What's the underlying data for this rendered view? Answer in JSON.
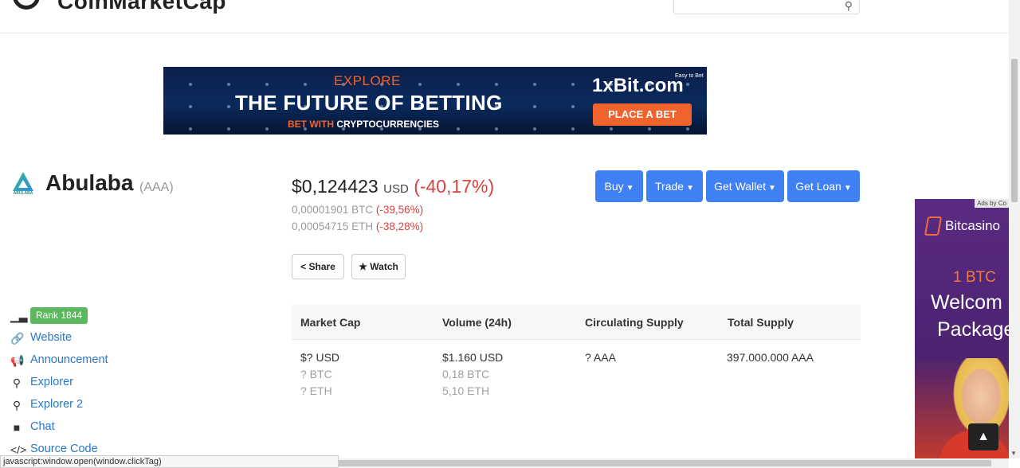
{
  "header": {
    "logo_text": "CoinMarketCap",
    "search_icon": "search-icon"
  },
  "banner": {
    "explore": "EXPLORE",
    "headline": "THE FUTURE OF BETTING",
    "bet_with": "BET WITH",
    "crypto": "CRYPTOCURRENCIES",
    "brand": "1xBit.com",
    "tagline": "Easy to Bet",
    "cta": "PLACE A BET"
  },
  "coin": {
    "logo_label": "ABULABA",
    "name": "Abulaba",
    "symbol": "(AAA)"
  },
  "price": {
    "usd_value": "$0,124423",
    "usd_label": "USD",
    "usd_change": "(-40,17%)",
    "btc_value": "0,00001901 BTC",
    "btc_change": "(-39,56%)",
    "eth_value": "0,00054715 ETH",
    "eth_change": "(-38,28%)"
  },
  "actions": {
    "buy": "Buy",
    "trade": "Trade",
    "get_wallet": "Get Wallet",
    "get_loan": "Get Loan",
    "share": "Share",
    "watch": "Watch"
  },
  "sidebar": {
    "rank": "Rank 1844",
    "links": [
      {
        "label": "Website",
        "icon": "link-icon"
      },
      {
        "label": "Announcement",
        "icon": "megaphone-icon"
      },
      {
        "label": "Explorer",
        "icon": "search-icon"
      },
      {
        "label": "Explorer 2",
        "icon": "search-icon"
      },
      {
        "label": "Chat",
        "icon": "chat-icon"
      },
      {
        "label": "Source Code",
        "icon": "code-icon"
      }
    ]
  },
  "stats": {
    "headers": [
      "Market Cap",
      "Volume (24h)",
      "Circulating Supply",
      "Total Supply"
    ],
    "market_cap": {
      "usd": "$? USD",
      "btc": "? BTC",
      "eth": "? ETH"
    },
    "volume": {
      "usd": "$1.160 USD",
      "btc": "0,18 BTC",
      "eth": "5,10 ETH"
    },
    "circulating": "? AAA",
    "total": "397.000.000 AAA"
  },
  "side_ad": {
    "ads_by": "Ads by Co",
    "brand": "Bitcasino",
    "btc": "1 BTC",
    "welcome": "Welcom",
    "package": "Package"
  },
  "status_bar": "javascript:window.open(window.clickTag)",
  "colors": {
    "accent_blue": "#3f81f5",
    "negative_red": "#d94040",
    "rank_green": "#5cb85c",
    "link_blue": "#2a78c7"
  }
}
